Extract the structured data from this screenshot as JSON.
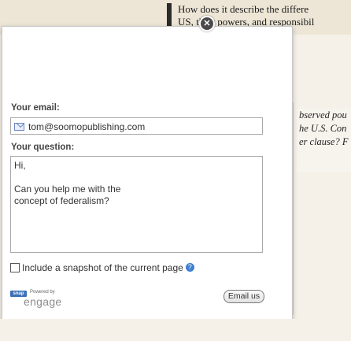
{
  "background": {
    "headline_line1": "How does it describe the differe",
    "headline_line2": "US, their powers, and responsibil",
    "column_lines": [
      "bserved pou",
      "he U.S. Con",
      "er clause? F"
    ]
  },
  "modal": {
    "email_label": "Your email:",
    "email_value": "tom@soomopublishing.com",
    "question_label": "Your question:",
    "question_line1": "Hi,",
    "question_body": "Can you help me with the concept of federalism?",
    "snapshot_label": "Include a snapshot of the current page",
    "snapshot_checked": false,
    "logo_badge": "snap",
    "logo_powered": "Powered by",
    "logo_name": "engage",
    "email_us_label": "Email us",
    "close_symbol": "✕"
  },
  "icons": {
    "close": "close-icon",
    "mail": "mail-icon",
    "help": "help-icon"
  },
  "colors": {
    "page_bg": "#f5f1e8",
    "help_blue": "#3e7fd1",
    "logo_blue": "#3b6fb6"
  }
}
